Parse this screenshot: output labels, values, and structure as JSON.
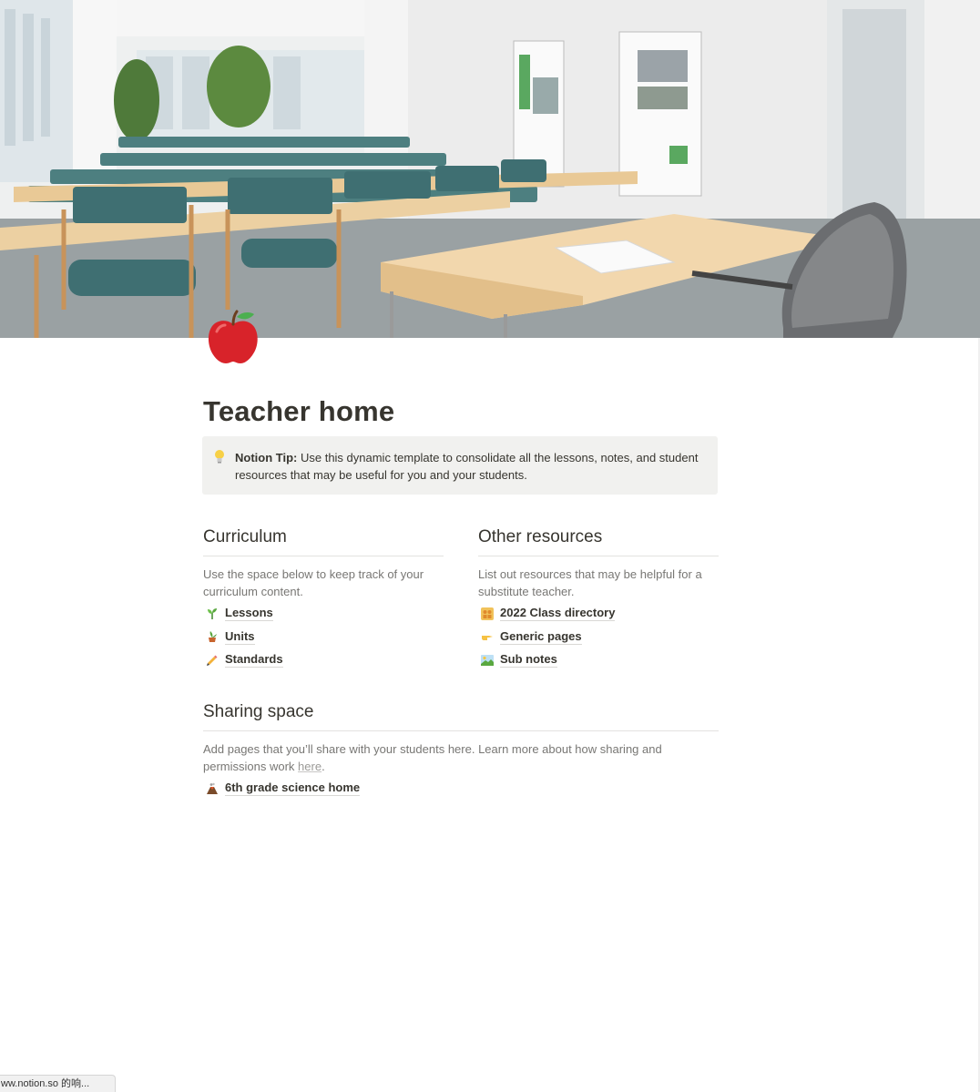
{
  "page": {
    "title": "Teacher home",
    "icon": "red-apple-icon"
  },
  "callout": {
    "icon": "lightbulb-icon",
    "label": "Notion Tip:",
    "text": " Use this dynamic template to consolidate all the lessons, notes, and student resources that may be useful for you and your students."
  },
  "curriculum": {
    "heading": "Curriculum",
    "description": "Use the space below to keep track of your curriculum content.",
    "links": [
      {
        "icon": "seedling-icon",
        "label": "Lessons"
      },
      {
        "icon": "potted-plant-icon",
        "label": "Units"
      },
      {
        "icon": "pencil-icon",
        "label": "Standards"
      }
    ]
  },
  "resources": {
    "heading": "Other resources",
    "description": "List out resources that may be helpful for a substitute teacher.",
    "links": [
      {
        "icon": "people-group-icon",
        "label": "2022 Class directory"
      },
      {
        "icon": "pointing-hand-icon",
        "label": "Generic pages"
      },
      {
        "icon": "landscape-icon",
        "label": "Sub notes"
      }
    ]
  },
  "sharing": {
    "heading": "Sharing space",
    "description_before": "Add pages that you’ll share with your students here. Learn more about how sharing and permissions work ",
    "link_text": "here",
    "description_after": ".",
    "links": [
      {
        "icon": "volcano-icon",
        "label": "6th grade science home"
      }
    ]
  },
  "statusbar": {
    "text": "ww.notion.so 的响..."
  }
}
